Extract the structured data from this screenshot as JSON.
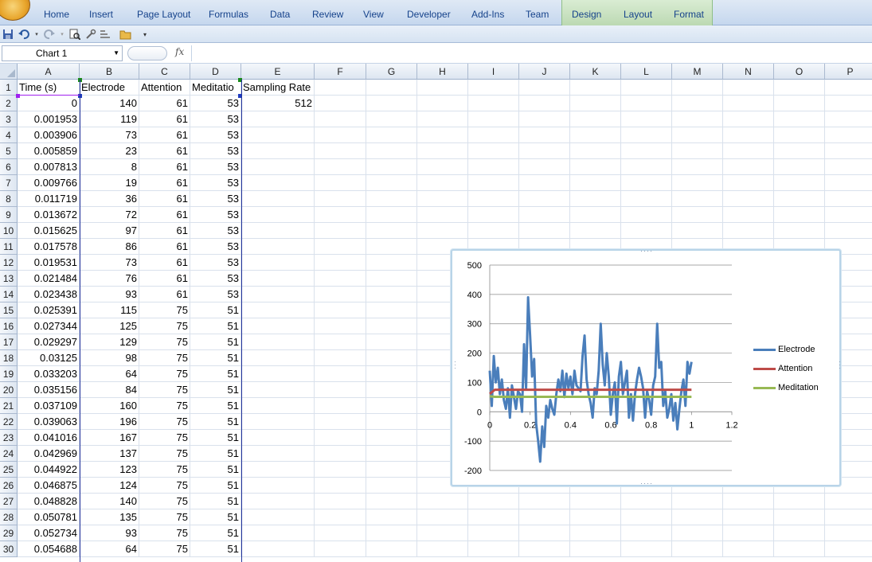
{
  "ribbon": {
    "tabs": [
      "Home",
      "Insert",
      "Page Layout",
      "Formulas",
      "Data",
      "Review",
      "View",
      "Developer",
      "Add-Ins",
      "Team",
      "Design",
      "Layout",
      "Format"
    ]
  },
  "quick_access": {
    "icons": [
      "save-icon",
      "undo-icon",
      "redo-icon",
      "print-preview-icon",
      "tools-icon",
      "sort-icon",
      "open-folder-icon",
      "customize-icon"
    ]
  },
  "formula_bar": {
    "name_box": "Chart 1",
    "fx_label": "fx",
    "value": ""
  },
  "sheet": {
    "columns": [
      "A",
      "B",
      "C",
      "D",
      "E",
      "F",
      "G",
      "H",
      "I",
      "J",
      "K",
      "L",
      "M",
      "N",
      "O",
      "P"
    ],
    "rows": [
      [
        "Time (s)",
        "Electrode",
        "Attention",
        "Meditatio",
        "Sampling Rate"
      ],
      [
        "0",
        "140",
        "61",
        "53",
        "512"
      ],
      [
        "0.001953",
        "119",
        "61",
        "53",
        ""
      ],
      [
        "0.003906",
        "73",
        "61",
        "53",
        ""
      ],
      [
        "0.005859",
        "23",
        "61",
        "53",
        ""
      ],
      [
        "0.007813",
        "8",
        "61",
        "53",
        ""
      ],
      [
        "0.009766",
        "19",
        "61",
        "53",
        ""
      ],
      [
        "0.011719",
        "36",
        "61",
        "53",
        ""
      ],
      [
        "0.013672",
        "72",
        "61",
        "53",
        ""
      ],
      [
        "0.015625",
        "97",
        "61",
        "53",
        ""
      ],
      [
        "0.017578",
        "86",
        "61",
        "53",
        ""
      ],
      [
        "0.019531",
        "73",
        "61",
        "53",
        ""
      ],
      [
        "0.021484",
        "76",
        "61",
        "53",
        ""
      ],
      [
        "0.023438",
        "93",
        "61",
        "53",
        ""
      ],
      [
        "0.025391",
        "115",
        "75",
        "51",
        ""
      ],
      [
        "0.027344",
        "125",
        "75",
        "51",
        ""
      ],
      [
        "0.029297",
        "129",
        "75",
        "51",
        ""
      ],
      [
        "0.03125",
        "98",
        "75",
        "51",
        ""
      ],
      [
        "0.033203",
        "64",
        "75",
        "51",
        ""
      ],
      [
        "0.035156",
        "84",
        "75",
        "51",
        ""
      ],
      [
        "0.037109",
        "160",
        "75",
        "51",
        ""
      ],
      [
        "0.039063",
        "196",
        "75",
        "51",
        ""
      ],
      [
        "0.041016",
        "167",
        "75",
        "51",
        ""
      ],
      [
        "0.042969",
        "137",
        "75",
        "51",
        ""
      ],
      [
        "0.044922",
        "123",
        "75",
        "51",
        ""
      ],
      [
        "0.046875",
        "124",
        "75",
        "51",
        ""
      ],
      [
        "0.048828",
        "140",
        "75",
        "51",
        ""
      ],
      [
        "0.050781",
        "135",
        "75",
        "51",
        ""
      ],
      [
        "0.052734",
        "93",
        "75",
        "51",
        ""
      ],
      [
        "0.054688",
        "64",
        "75",
        "51",
        ""
      ]
    ]
  },
  "chart_data": {
    "type": "line",
    "title": "",
    "xlabel": "",
    "ylabel": "",
    "xlim": [
      0,
      1.2
    ],
    "ylim": [
      -200,
      500
    ],
    "x_ticks": [
      "0",
      "0.2",
      "0.4",
      "0.6",
      "0.8",
      "1",
      "1.2"
    ],
    "y_ticks": [
      "500",
      "400",
      "300",
      "200",
      "100",
      "0",
      "-100",
      "-200"
    ],
    "grid": true,
    "legend": "right",
    "series": [
      {
        "name": "Electrode",
        "color": "#4a7ebb",
        "x": [
          0,
          0.01,
          0.02,
          0.03,
          0.04,
          0.05,
          0.06,
          0.07,
          0.08,
          0.09,
          0.1,
          0.11,
          0.12,
          0.13,
          0.14,
          0.15,
          0.16,
          0.17,
          0.18,
          0.19,
          0.2,
          0.21,
          0.22,
          0.23,
          0.24,
          0.25,
          0.26,
          0.27,
          0.28,
          0.29,
          0.3,
          0.31,
          0.32,
          0.33,
          0.34,
          0.35,
          0.36,
          0.37,
          0.38,
          0.39,
          0.4,
          0.41,
          0.42,
          0.43,
          0.44,
          0.45,
          0.46,
          0.47,
          0.48,
          0.49,
          0.5,
          0.51,
          0.52,
          0.53,
          0.54,
          0.55,
          0.56,
          0.57,
          0.58,
          0.59,
          0.6,
          0.61,
          0.62,
          0.63,
          0.64,
          0.65,
          0.66,
          0.67,
          0.68,
          0.69,
          0.7,
          0.71,
          0.72,
          0.73,
          0.74,
          0.75,
          0.76,
          0.77,
          0.78,
          0.79,
          0.8,
          0.81,
          0.82,
          0.83,
          0.84,
          0.85,
          0.86,
          0.87,
          0.88,
          0.89,
          0.9,
          0.91,
          0.92,
          0.93,
          0.94,
          0.95,
          0.96,
          0.97,
          0.98,
          0.99,
          1.0
        ],
        "values": [
          140,
          20,
          190,
          100,
          150,
          60,
          110,
          40,
          10,
          80,
          -20,
          90,
          50,
          10,
          70,
          60,
          0,
          230,
          80,
          390,
          260,
          120,
          180,
          -40,
          -100,
          -170,
          -50,
          -120,
          20,
          -20,
          40,
          10,
          -10,
          60,
          110,
          70,
          140,
          50,
          130,
          80,
          120,
          60,
          140,
          90,
          80,
          70,
          190,
          260,
          110,
          60,
          30,
          -20,
          80,
          60,
          140,
          300,
          160,
          90,
          200,
          120,
          -10,
          60,
          100,
          -40,
          120,
          170,
          60,
          100,
          140,
          -20,
          60,
          -30,
          60,
          110,
          150,
          120,
          80,
          -20,
          70,
          40,
          -10,
          90,
          120,
          300,
          150,
          170,
          20,
          70,
          -20,
          10,
          60,
          -30,
          30,
          -60,
          10,
          70,
          110,
          20,
          170,
          130,
          170
        ]
      },
      {
        "name": "Attention",
        "color": "#be4b48",
        "x": [
          0,
          0.025,
          1.0
        ],
        "values": [
          61,
          75,
          75
        ]
      },
      {
        "name": "Meditation",
        "color": "#98b954",
        "x": [
          0,
          0.025,
          1.0
        ],
        "values": [
          53,
          51,
          51
        ]
      }
    ]
  }
}
